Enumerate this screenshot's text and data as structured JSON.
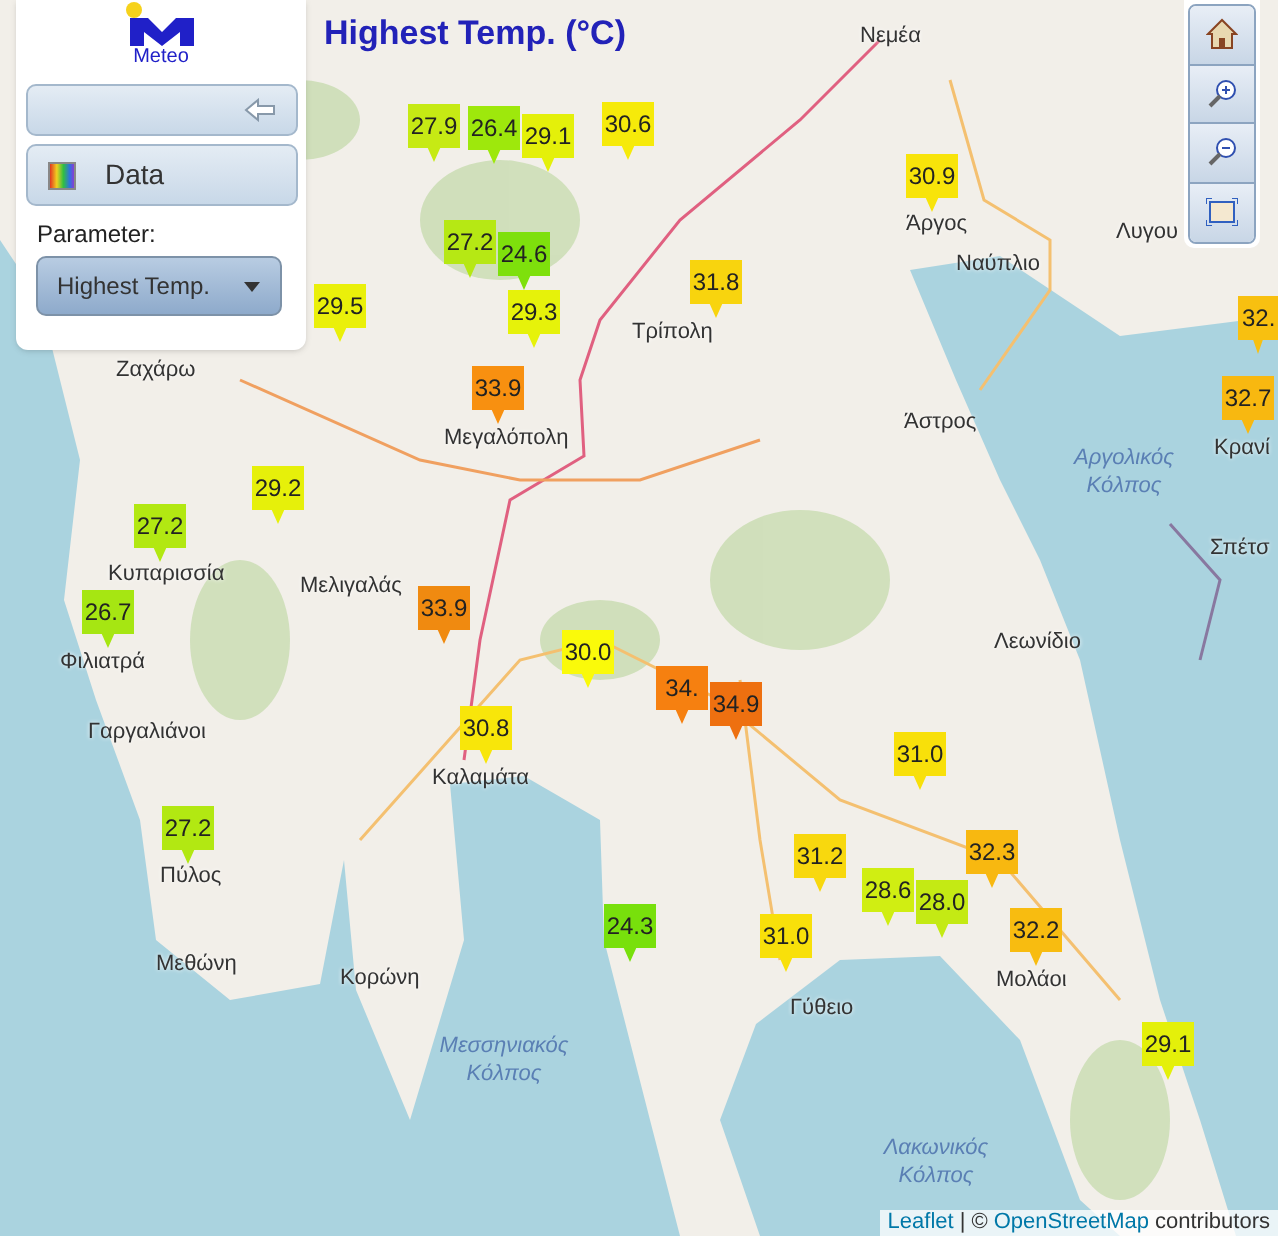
{
  "title": "Highest Temp. (°C)",
  "panel": {
    "logo_text": "Meteo",
    "data_button": "Data",
    "parameter_label": "Parameter:",
    "parameter_select": "Highest Temp."
  },
  "places": [
    {
      "name": "Νεμέα",
      "kind": "town"
    },
    {
      "name": "Άργος",
      "kind": "town"
    },
    {
      "name": "Ναύπλιο",
      "kind": "town"
    },
    {
      "name": "Λυγου",
      "kind": "town"
    },
    {
      "name": "Τρίπολη",
      "kind": "town"
    },
    {
      "name": "Άστρος",
      "kind": "town"
    },
    {
      "name": "Αργολικός Κόλπος",
      "kind": "sea"
    },
    {
      "name": "Κρανί",
      "kind": "town"
    },
    {
      "name": "Σπέτσ",
      "kind": "town"
    },
    {
      "name": "Ζαχάρω",
      "kind": "town"
    },
    {
      "name": "Μεγαλόπολη",
      "kind": "town"
    },
    {
      "name": "Κυπαρισσία",
      "kind": "town"
    },
    {
      "name": "Φιλιατρά",
      "kind": "town"
    },
    {
      "name": "Μελιγαλάς",
      "kind": "town"
    },
    {
      "name": "Γαργαλιάνοι",
      "kind": "town"
    },
    {
      "name": "Καλαμάτα",
      "kind": "town"
    },
    {
      "name": "Λεωνίδιο",
      "kind": "town"
    },
    {
      "name": "Πύλος",
      "kind": "town"
    },
    {
      "name": "Μεθώνη",
      "kind": "town"
    },
    {
      "name": "Κορώνη",
      "kind": "town"
    },
    {
      "name": "Μεσσηνιακός Κόλπος",
      "kind": "sea"
    },
    {
      "name": "Μολάοι",
      "kind": "town"
    },
    {
      "name": "Γύθειο",
      "kind": "town"
    },
    {
      "name": "Λακωνικός Κόλπος",
      "kind": "sea"
    }
  ],
  "markers": [
    {
      "value": "27.9",
      "color": "#c6ea14"
    },
    {
      "value": "26.4",
      "color": "#9ee80c"
    },
    {
      "value": "29.1",
      "color": "#e4f00a"
    },
    {
      "value": "30.6",
      "color": "#f6ea0a"
    },
    {
      "value": "30.9",
      "color": "#f8e40a"
    },
    {
      "value": "27.2",
      "color": "#b6e814"
    },
    {
      "value": "24.6",
      "color": "#7ee00c"
    },
    {
      "value": "29.5",
      "color": "#eaf00a"
    },
    {
      "value": "29.3",
      "color": "#e6f20a"
    },
    {
      "value": "31.8",
      "color": "#f8d40e"
    },
    {
      "value": "33.9",
      "color": "#f89010"
    },
    {
      "value": "32.",
      "color": "#f8c010"
    },
    {
      "value": "32.7",
      "color": "#f8b810"
    },
    {
      "value": "29.2",
      "color": "#e6f00a"
    },
    {
      "value": "27.2",
      "color": "#b2e812"
    },
    {
      "value": "26.7",
      "color": "#a6e612"
    },
    {
      "value": "33.9",
      "color": "#f08a10"
    },
    {
      "value": "30.0",
      "color": "#fafa0a"
    },
    {
      "value": "30.8",
      "color": "#f8e60a"
    },
    {
      "value": "34.",
      "color": "#f68010"
    },
    {
      "value": "34.9",
      "color": "#ee7010"
    },
    {
      "value": "31.0",
      "color": "#f8e00a"
    },
    {
      "value": "31.2",
      "color": "#f8d80e"
    },
    {
      "value": "32.3",
      "color": "#f8b810"
    },
    {
      "value": "28.6",
      "color": "#d0ee12"
    },
    {
      "value": "28.0",
      "color": "#c4ea14"
    },
    {
      "value": "24.3",
      "color": "#78e00c"
    },
    {
      "value": "31.0",
      "color": "#f8e00a"
    },
    {
      "value": "32.2",
      "color": "#f8bc10"
    },
    {
      "value": "27.2",
      "color": "#b2e812"
    },
    {
      "value": "29.1",
      "color": "#e4f00a"
    }
  ],
  "attribution": [
    {
      "text": "Leaflet",
      "kind": "link"
    },
    {
      "text": "| ©",
      "kind": "text"
    },
    {
      "text": "OpenStreetMap",
      "kind": "link"
    },
    {
      "text": "contributors",
      "kind": "text"
    }
  ]
}
